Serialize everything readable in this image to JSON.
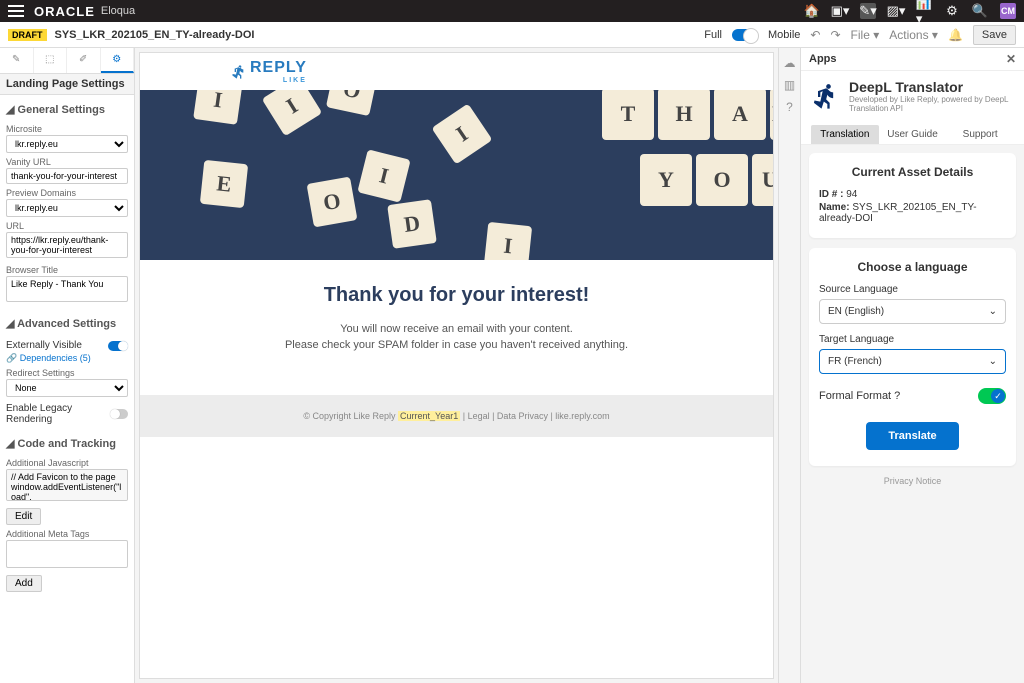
{
  "topbar": {
    "brand": "ORACLE",
    "product": "Eloqua",
    "avatar": "CM"
  },
  "secbar": {
    "draft": "DRAFT",
    "asset_name": "SYS_LKR_202105_EN_TY-already-DOI",
    "full": "Full",
    "mobile": "Mobile",
    "file": "File ▾",
    "actions": "Actions ▾",
    "save": "Save"
  },
  "leftpanel": {
    "title": "Landing Page Settings",
    "general": "General Settings",
    "microsite_label": "Microsite",
    "microsite_value": "lkr.reply.eu",
    "vanity_label": "Vanity URL",
    "vanity_value": "thank-you-for-your-interest",
    "preview_label": "Preview Domains",
    "preview_value": "lkr.reply.eu",
    "url_label": "URL",
    "url_value": "https://lkr.reply.eu/thank-you-for-your-interest",
    "browser_label": "Browser Title",
    "browser_value": "Like Reply - Thank You",
    "advanced": "Advanced Settings",
    "ext_vis": "Externally Visible",
    "dependencies": "Dependencies (5)",
    "redirect_label": "Redirect Settings",
    "redirect_value": "None",
    "legacy": "Enable Legacy Rendering",
    "code": "Code and Tracking",
    "addjs_label": "Additional Javascript",
    "addjs_value": "// Add Favicon to the page\nwindow.addEventListener(\"load\",\nfunction() {",
    "edit": "Edit",
    "meta_label": "Additional Meta Tags",
    "add": "Add"
  },
  "page": {
    "logo_text": "REPLY",
    "logo_sub": "LIKE",
    "headline": "Thank you for your interest!",
    "p1": "You will now receive an email with your content.",
    "p2": "Please check your SPAM folder in case you haven't received anything.",
    "footer_copy": "© Copyright Like Reply ",
    "footer_year": "Current_Year1",
    "footer_legal": "  |  Legal  |  Data Privacy   |   like.reply.com"
  },
  "apps": {
    "panel_title": "Apps",
    "app_title": "DeepL Translator",
    "app_sub": "Developed by Like Reply, powered by DeepL Translation API",
    "tabs": {
      "translation": "Translation",
      "guide": "User Guide",
      "support": "Support"
    },
    "card1_title": "Current Asset Details",
    "id_label": "ID # : ",
    "id_value": "94",
    "name_label": "Name: ",
    "name_value": "SYS_LKR_202105_EN_TY-already-DOI",
    "card2_title": "Choose a language",
    "src_label": "Source Language",
    "src_value": "EN (English)",
    "tgt_label": "Target Language",
    "tgt_value": "FR (French)",
    "formal": "Formal Format ?",
    "translate": "Translate",
    "privacy": "Privacy Notice"
  }
}
